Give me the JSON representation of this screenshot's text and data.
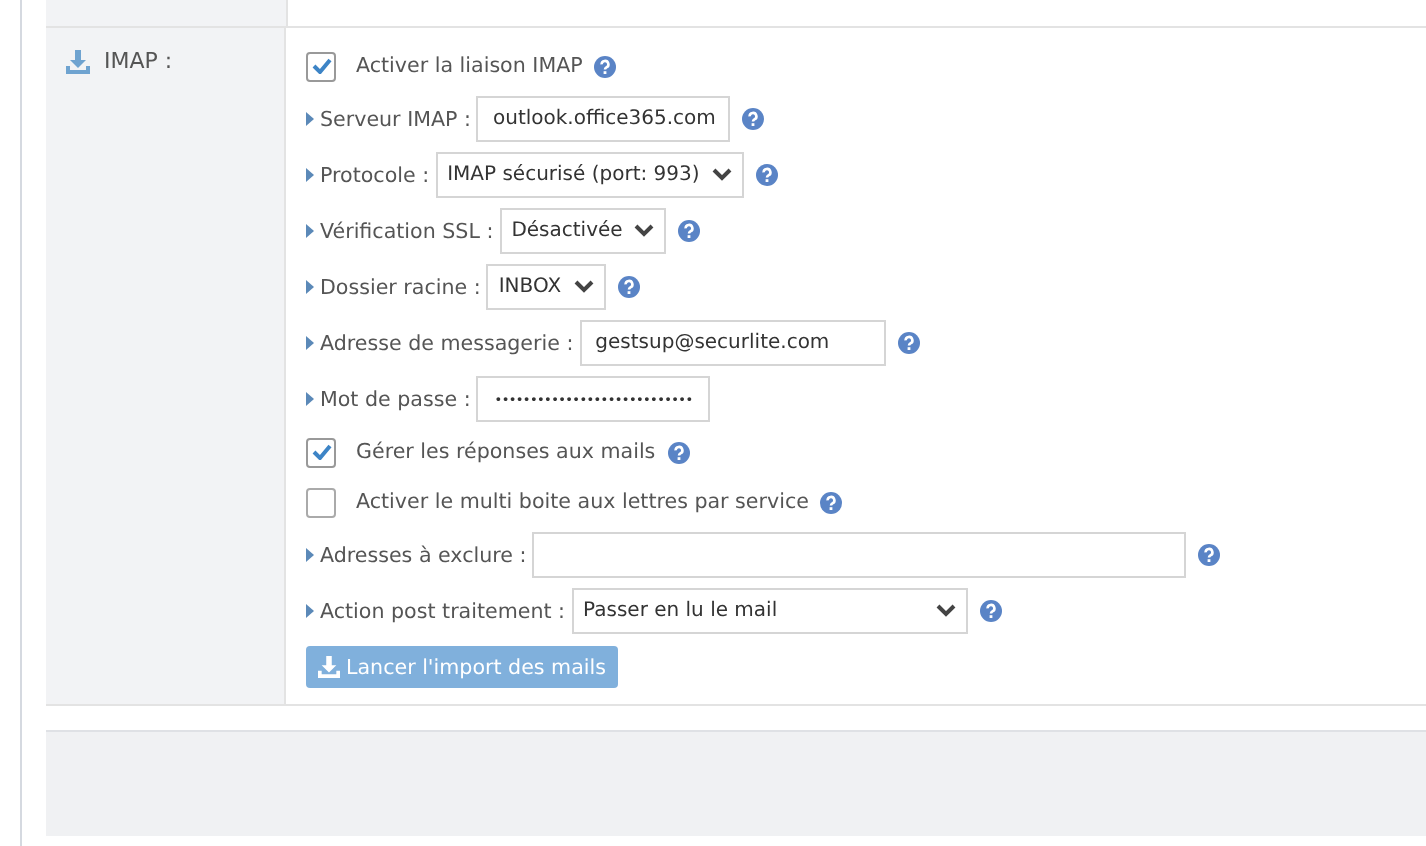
{
  "section": {
    "label": "IMAP :"
  },
  "fields": [
    {
      "kind": "checkbox",
      "label": "Activer la liaison IMAP",
      "checked": true,
      "help": true
    },
    {
      "kind": "text",
      "label": "Serveur IMAP :",
      "value": "outlook.office365.com",
      "help": true
    },
    {
      "kind": "select",
      "label": "Protocole :",
      "value": "IMAP sécurisé (port: 993)",
      "help": true
    },
    {
      "kind": "select",
      "label": "Vérification SSL :",
      "value": "Désactivée",
      "help": true
    },
    {
      "kind": "select",
      "label": "Dossier racine :",
      "value": "INBOX",
      "help": true
    },
    {
      "kind": "text",
      "label": "Adresse de messagerie :",
      "value": "gestsup@securlite.com",
      "help": true
    },
    {
      "kind": "text",
      "label": "Mot de passe :",
      "value": "••••••••••••••••••••••••••••",
      "help": false
    },
    {
      "kind": "checkbox",
      "label": "Gérer les réponses aux mails",
      "checked": true,
      "help": true
    },
    {
      "kind": "checkbox",
      "label": "Activer le multi boite aux lettres par service",
      "checked": false,
      "help": true
    },
    {
      "kind": "text",
      "label": "Adresses à exclure :",
      "help": true
    },
    {
      "kind": "select",
      "label": "Action post traitement :",
      "value": "Passer en lu le mail",
      "help": true
    }
  ],
  "button": {
    "label": "Lancer l'import des mails"
  }
}
